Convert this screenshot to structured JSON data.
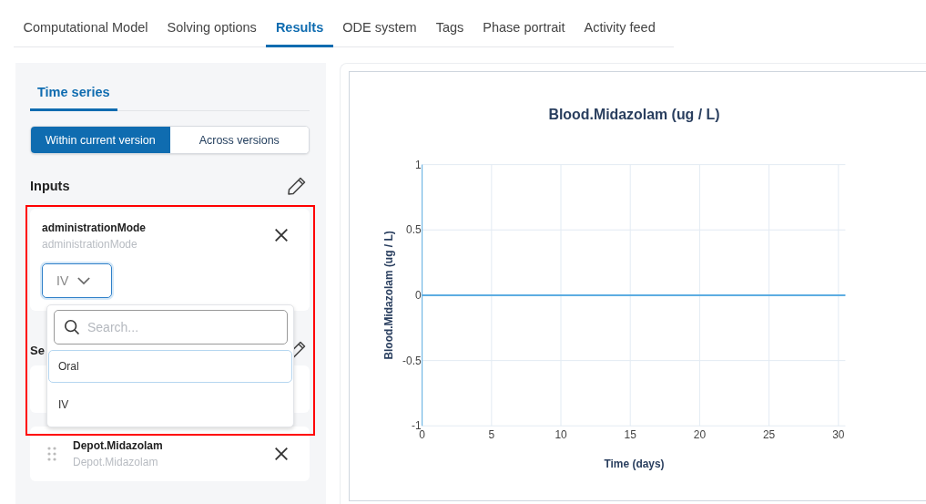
{
  "tabs": [
    {
      "label": "Computational Model",
      "selected": false
    },
    {
      "label": "Solving options",
      "selected": false
    },
    {
      "label": "Results",
      "selected": true
    },
    {
      "label": "ODE system",
      "selected": false
    },
    {
      "label": "Tags",
      "selected": false
    },
    {
      "label": "Phase portrait",
      "selected": false
    },
    {
      "label": "Activity feed",
      "selected": false
    }
  ],
  "sidebar": {
    "tabs": [
      {
        "label": "Time series",
        "selected": true
      }
    ],
    "modes": [
      {
        "label": "Within current version",
        "selected": true
      },
      {
        "label": "Across versions",
        "selected": false
      }
    ],
    "inputs": {
      "heading": "Inputs",
      "cards": [
        {
          "title": "administrationMode",
          "subtitle": "administrationMode",
          "value": "IV",
          "dropdown": {
            "search": {
              "placeholder": "Search..."
            },
            "options": [
              {
                "label": "Oral",
                "selected": true
              },
              {
                "label": "IV",
                "selected": false
              }
            ]
          }
        }
      ]
    },
    "section_2": {
      "heading": "Se",
      "cards": [
        {
          "title": "Depot.Midazolam",
          "subtitle": "Depot.Midazolam"
        }
      ]
    }
  },
  "chart": {
    "chart_data": {
      "type": "line",
      "title": "Blood.Midazolam (ug / L)",
      "xlabel": "Time (days)",
      "ylabel": "Blood.Midazolam (ug / L)",
      "x": [
        0,
        30.5
      ],
      "series": [
        {
          "color": "#5dade2",
          "values": [
            0,
            0
          ]
        }
      ],
      "grid": true,
      "xlim": [
        0,
        30.5
      ],
      "ylim": [
        -1,
        1
      ],
      "xticks": [
        0,
        5,
        10,
        15,
        20,
        25,
        30
      ],
      "yticks": [
        -1,
        -0.5,
        0,
        0.5,
        1
      ]
    }
  }
}
